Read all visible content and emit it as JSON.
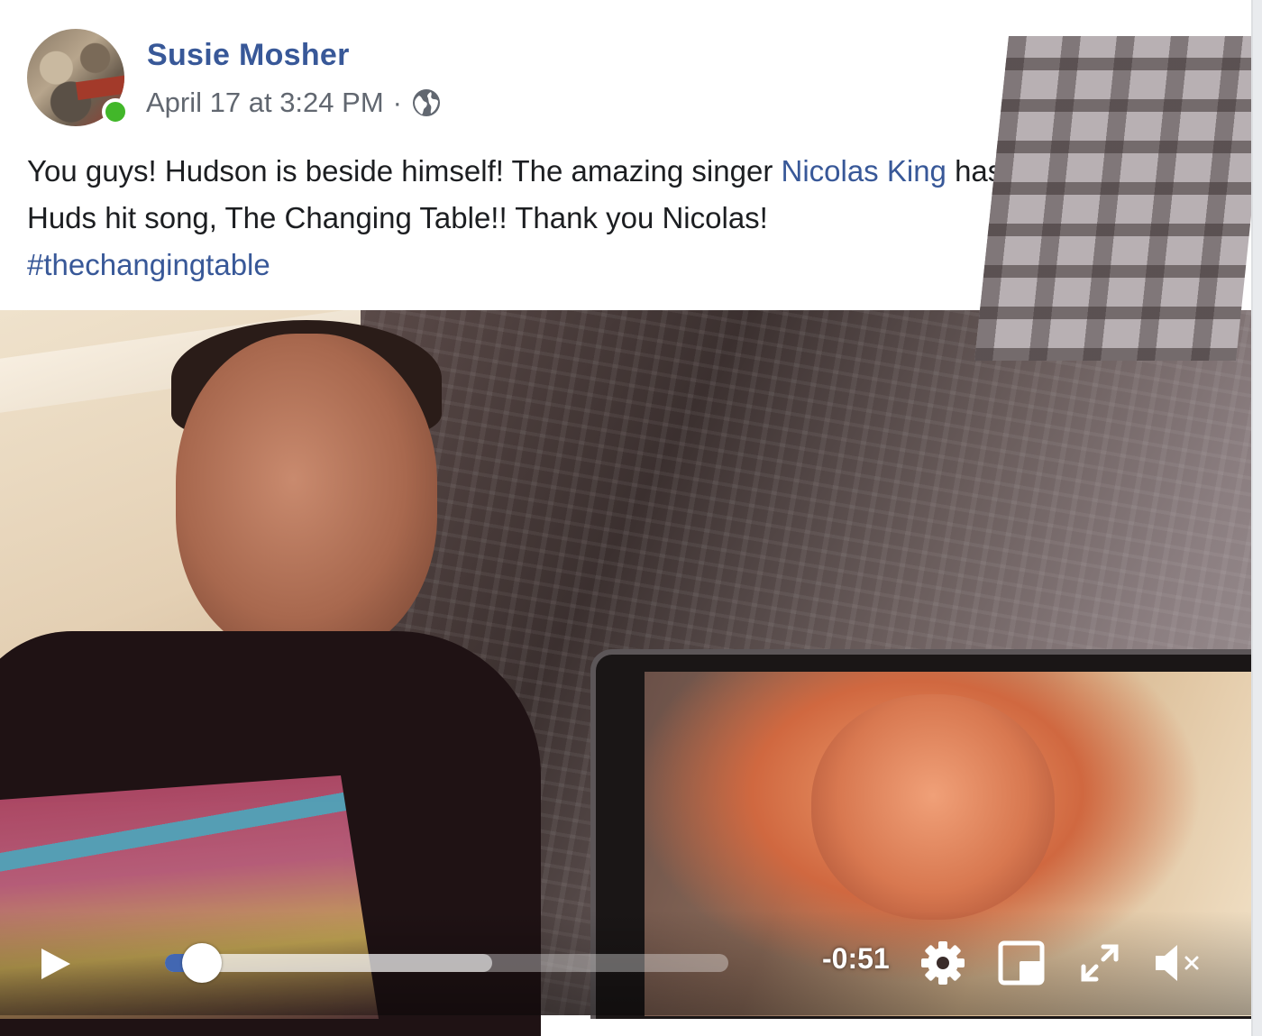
{
  "post": {
    "author": "Susie Mosher",
    "timestamp": "April 17 at 3:24 PM",
    "separator": "·",
    "privacy_icon": "globe-icon",
    "more_icon": "more-options-icon",
    "text_parts": {
      "part1": "You guys! Hudson is beside himself! The amazing singer ",
      "mention": "Nicolas King",
      "part2": " has done a cover of Huds hit song, The Changing Table!! Thank you Nicolas! ",
      "hashtag": "#thechangingtable"
    }
  },
  "video": {
    "time_remaining": "-0:51",
    "played_fraction": 0.05,
    "buffered_fraction": 0.58,
    "muted": true,
    "controls": [
      "play-icon",
      "gear-icon",
      "pip-icon",
      "fullscreen-icon",
      "volume-muted-icon"
    ]
  },
  "colors": {
    "link": "#385898",
    "online": "#42b72a",
    "progress": "#4267b2"
  }
}
